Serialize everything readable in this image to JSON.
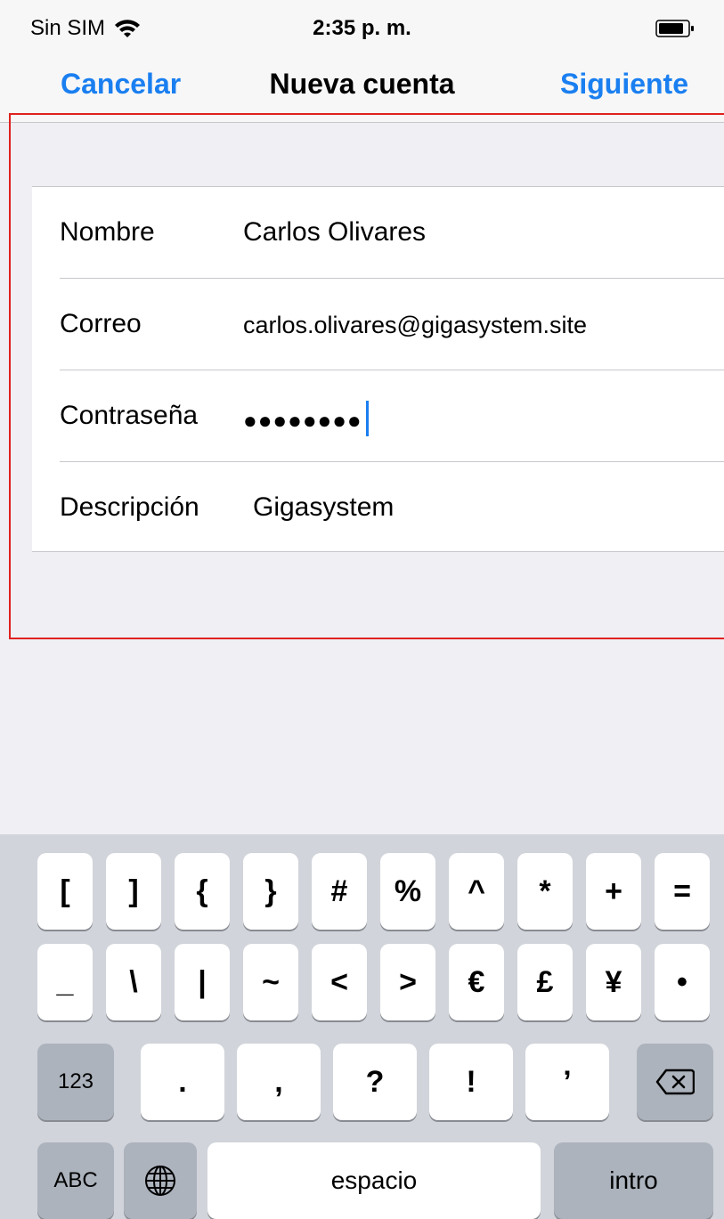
{
  "status_bar": {
    "carrier": "Sin SIM",
    "time": "2:35 p. m.",
    "icons": [
      "wifi-icon",
      "battery-icon"
    ]
  },
  "nav": {
    "cancel_label": "Cancelar",
    "title": "Nueva cuenta",
    "next_label": "Siguiente",
    "accent_color": "#1a7ff0"
  },
  "form": {
    "fields": [
      {
        "label": "Nombre",
        "value": "Carlos Olivares"
      },
      {
        "label": "Correo",
        "value": "carlos.olivares@gigasystem.site"
      },
      {
        "label": "Contraseña",
        "value": "●●●●●●●●"
      },
      {
        "label": "Descripción",
        "value": "Gigasystem"
      }
    ]
  },
  "highlight_color": "#e02020",
  "keyboard": {
    "row1": [
      "[",
      "]",
      "{",
      "}",
      "#",
      "%",
      "^",
      "*",
      "+",
      "="
    ],
    "row2": [
      "_",
      "\\",
      "|",
      "~",
      "<",
      ">",
      "€",
      "£",
      "¥",
      "•"
    ],
    "row3": {
      "mode_key": "123",
      "keys": [
        ".",
        ",",
        "?",
        "!",
        "’"
      ],
      "backspace_icon": "backspace-icon"
    },
    "row4": {
      "abc_key": "ABC",
      "globe_icon": "globe-icon",
      "space_label": "espacio",
      "return_label": "intro"
    }
  }
}
